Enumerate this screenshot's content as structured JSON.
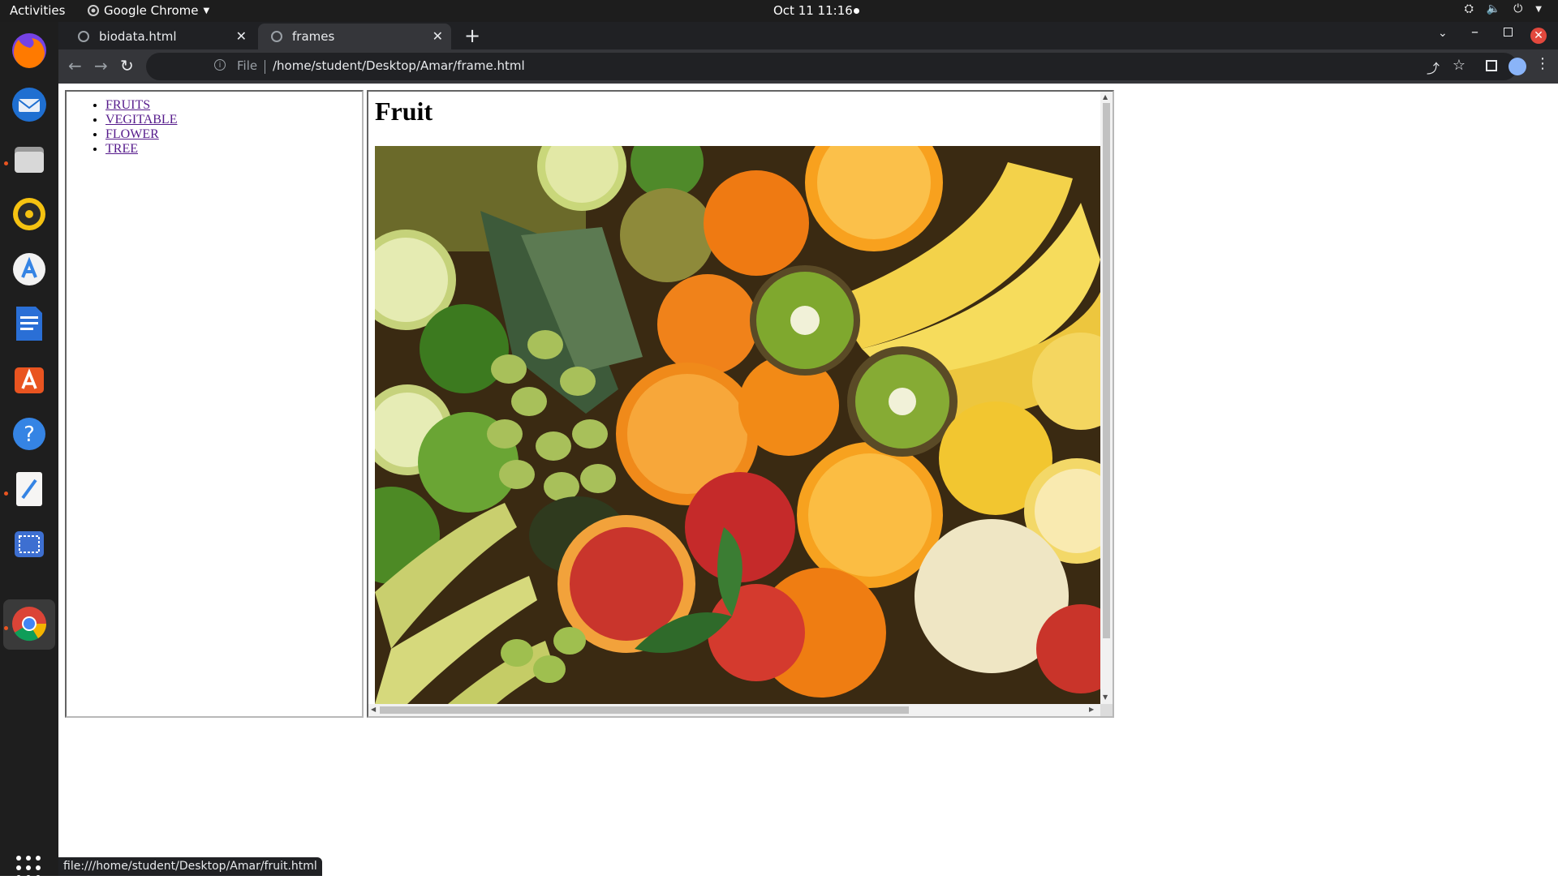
{
  "topbar": {
    "activities": "Activities",
    "app_name": "Google Chrome",
    "clock": "Oct 11  11:16"
  },
  "dock": {
    "apps": [
      "firefox-icon",
      "thunderbird-icon",
      "files-icon",
      "rhythmbox-icon",
      "app-installer-icon",
      "libreoffice-writer-icon",
      "ubuntu-software-icon",
      "help-icon",
      "text-editor-icon",
      "screenshot-icon",
      "chrome-icon",
      "show-applications-icon"
    ]
  },
  "browser": {
    "tabs": [
      {
        "title": "biodata.html",
        "active": false
      },
      {
        "title": "frames",
        "active": true
      }
    ],
    "omnibox": {
      "scheme_label": "File",
      "url": "/home/student/Desktop/Amar/frame.html"
    },
    "status_url": "file:///home/student/Desktop/Amar/fruit.html"
  },
  "page": {
    "nav_links": [
      "FRUITS",
      "VEGITABLE",
      "FLOWER",
      "TREE"
    ],
    "heading": "Fruit",
    "image_alt": "Assorted fresh fruits: pineapple, oranges, kiwis, bananas, limes, grapes, apples, blood orange"
  },
  "colors": {
    "link_visited": "#551a8b",
    "chrome_dark": "#202124",
    "ubuntu_orange": "#e95420"
  }
}
